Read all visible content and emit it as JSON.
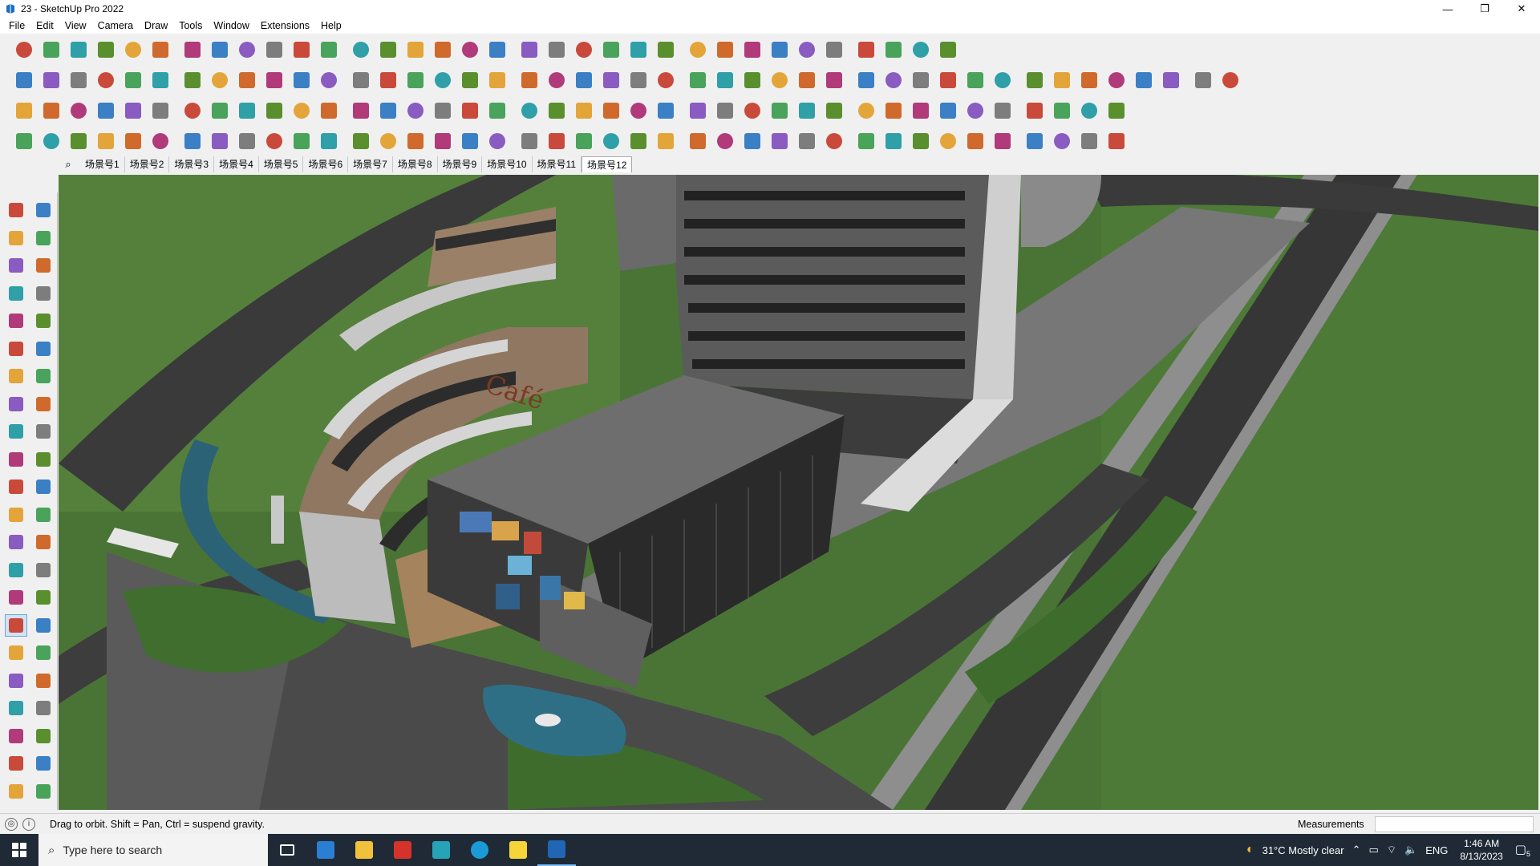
{
  "window": {
    "title": "23 - SketchUp Pro 2022",
    "controls": [
      "—",
      "❐",
      "✕"
    ]
  },
  "menu": [
    "File",
    "Edit",
    "View",
    "Camera",
    "Draw",
    "Tools",
    "Window",
    "Extensions",
    "Help"
  ],
  "scenes": {
    "tabs": [
      "场景号1",
      "场景号2",
      "场景号3",
      "场景号4",
      "场景号5",
      "场景号6",
      "场景号7",
      "场景号8",
      "场景号9",
      "场景号10",
      "场景号11",
      "场景号12"
    ],
    "active_index": 11
  },
  "status": {
    "message": "Drag to orbit. Shift = Pan, Ctrl = suspend gravity.",
    "measurements_label": "Measurements",
    "measurements_value": ""
  },
  "taskbar": {
    "search_placeholder": "Type here to search",
    "weather": "31°C  Mostly clear",
    "language": "ENG",
    "time": "1:46 AM",
    "date": "8/13/2023",
    "notification_count": "5"
  },
  "colors": {
    "accent": "#3b8fd8",
    "grass": "#4f7a38",
    "road": "#3d3d3d",
    "roof": "#6e6e6e",
    "water": "#2f6f86"
  }
}
